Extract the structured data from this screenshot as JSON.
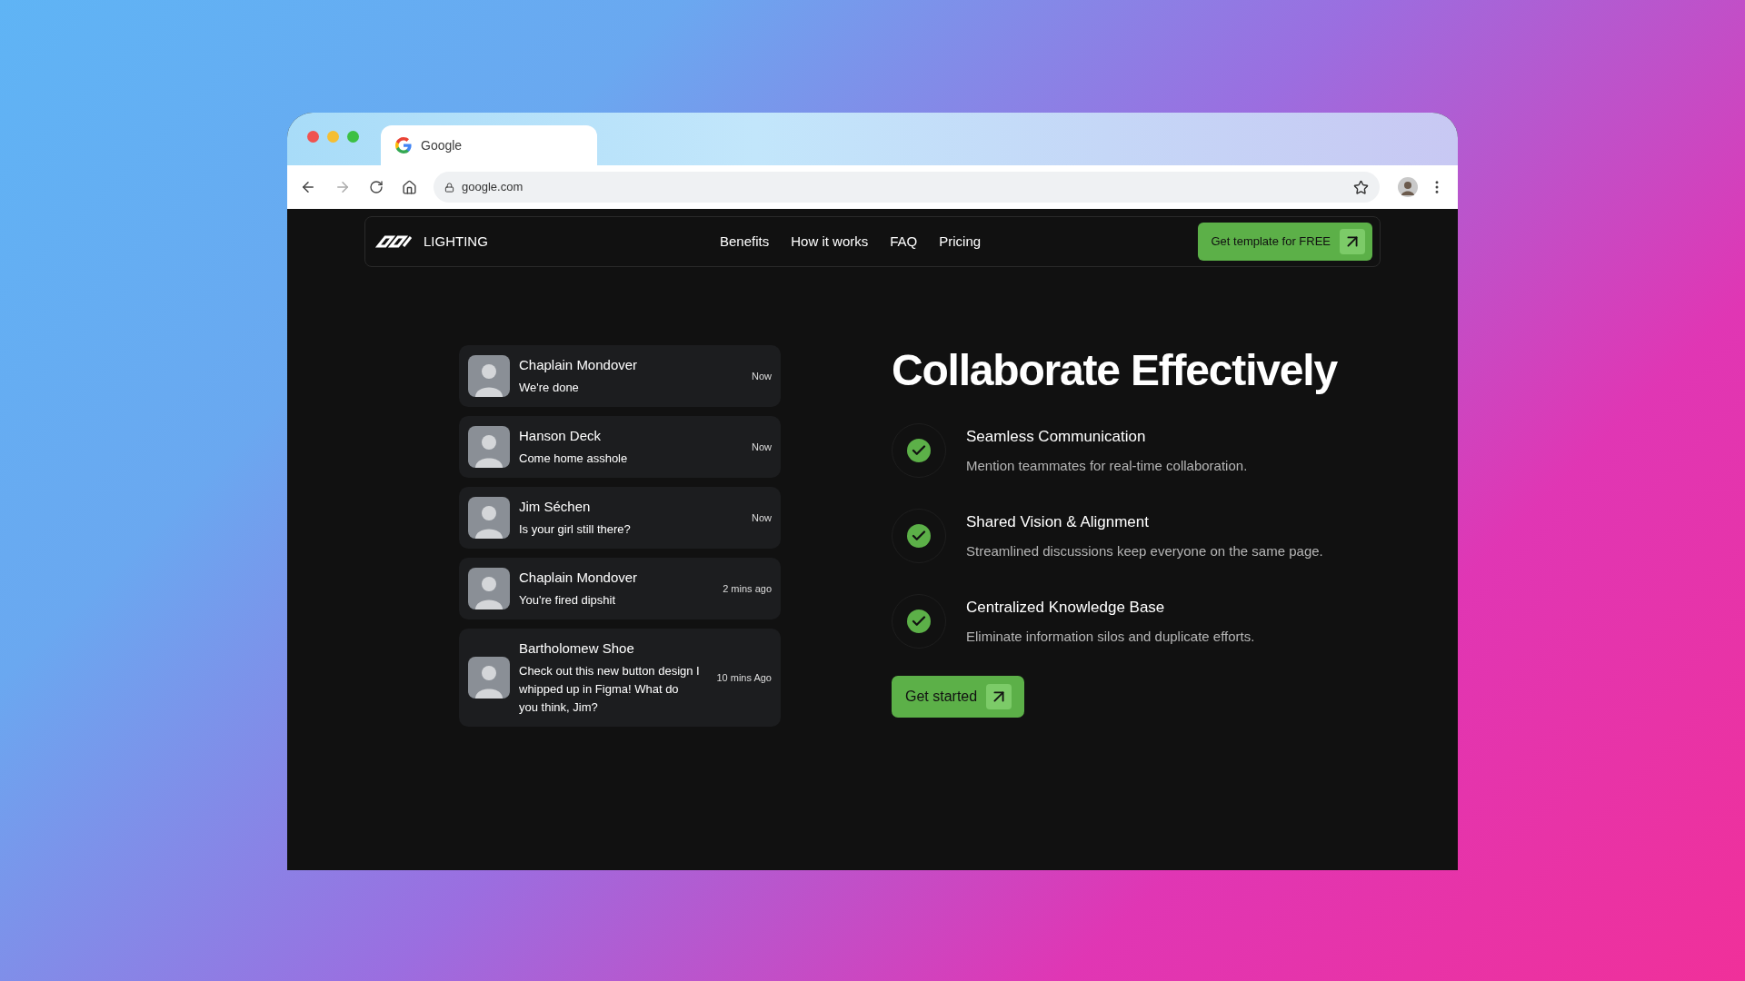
{
  "browser": {
    "tab_title": "Google",
    "url": "google.com"
  },
  "nav": {
    "brand": "LIGHTING",
    "links": [
      "Benefits",
      "How it works",
      "FAQ",
      "Pricing"
    ],
    "cta": "Get template for FREE"
  },
  "messages": [
    {
      "name": "Chaplain Mondover",
      "text": "We're done",
      "time": "Now"
    },
    {
      "name": "Hanson Deck",
      "text": "Come home asshole",
      "time": "Now"
    },
    {
      "name": "Jim Séchen",
      "text": "Is your girl still there?",
      "time": "Now"
    },
    {
      "name": "Chaplain Mondover",
      "text": "You're fired dipshit",
      "time": "2 mins ago"
    },
    {
      "name": "Bartholomew Shoe",
      "text": "Check out this new button design I whipped up in Figma! What do you think, Jim?",
      "time": "10 mins Ago"
    }
  ],
  "heading": "Collaborate Effectively",
  "features": [
    {
      "title": "Seamless Communication",
      "text": "Mention teammates for real-time collaboration."
    },
    {
      "title": "Shared Vision & Alignment",
      "text": "Streamlined discussions keep everyone on the same page."
    },
    {
      "title": "Centralized Knowledge Base",
      "text": "Eliminate information silos and duplicate efforts."
    }
  ],
  "button": "Get started"
}
